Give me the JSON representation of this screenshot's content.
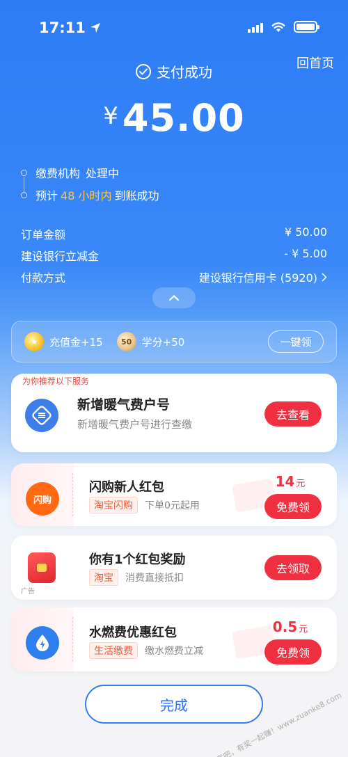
{
  "status_bar": {
    "time": "17:11"
  },
  "header": {
    "home_link": "回首页",
    "title": "支付成功"
  },
  "payment": {
    "currency": "¥",
    "amount": "45.00"
  },
  "timeline": {
    "step1_label": "缴费机构",
    "step1_status": "处理中",
    "step2_prefix": "预计",
    "step2_highlight": "48 小时内",
    "step2_suffix": "到账成功"
  },
  "details": [
    {
      "label": "订单金额",
      "value": "¥ 50.00"
    },
    {
      "label": "建设银行立减金",
      "value": "- ¥ 5.00"
    },
    {
      "label": "付款方式",
      "value": "建设银行信用卡 (5920)"
    }
  ],
  "rewards": {
    "coin_label": "充值金+15",
    "score_coin_text": "50",
    "score_label": "学分+50",
    "claim_all": "一键领"
  },
  "recommend": {
    "tag": "为你推荐以下服务",
    "title": "新增暖气费户号",
    "subtitle": "新增暖气费户号进行查缴",
    "button": "去查看"
  },
  "coupons": [
    {
      "icon_text": "闪购",
      "title": "闪购新人红包",
      "tag": "淘宝闪购",
      "note": "下单0元起用",
      "price": "14",
      "unit": "元",
      "button": "免费领"
    },
    {
      "title": "你有1个红包奖励",
      "tag": "淘宝",
      "note": "消费直接抵扣",
      "ad": "广告",
      "button": "去领取"
    },
    {
      "title": "水燃费优惠红包",
      "tag": "生活缴费",
      "note": "缴水燃费立减",
      "price": "0.5",
      "unit": "元",
      "button": "免费领"
    }
  ],
  "done_button": "完成",
  "watermark": "赚客吧，有奖一起赚！www.zuanke8.com",
  "colors": {
    "primary_blue": "#2d7cf6",
    "accent_red": "#f03040",
    "highlight_yellow": "#ffc845"
  },
  "icons": [
    "location-arrow-icon",
    "cellular-signal-icon",
    "wifi-icon",
    "battery-icon",
    "check-circle-icon",
    "chevron-right-icon",
    "chevron-up-icon",
    "coin-icon",
    "score-coin-icon",
    "heating-account-icon",
    "shangou-icon",
    "red-packet-icon",
    "water-fee-icon"
  ]
}
